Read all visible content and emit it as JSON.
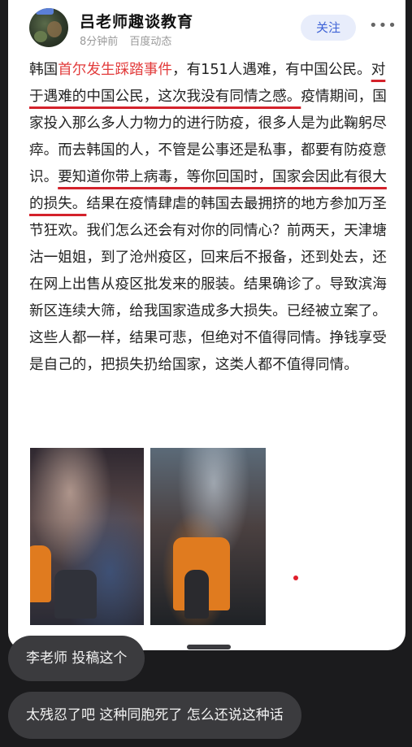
{
  "post": {
    "author": "吕老师趣谈教育",
    "time": "8分钟前",
    "source": "百度动态",
    "follow_label": "关注",
    "more_icon": "more-dots-icon",
    "paragraph": [
      {
        "text": "韩国",
        "style": ""
      },
      {
        "text": "首尔发生踩踏事件",
        "style": "hl"
      },
      {
        "text": "，有151人遇难，有中国公民。",
        "style": ""
      },
      {
        "text": "对于遇难的中国公民，这次我没有同情之感。",
        "style": "ul"
      },
      {
        "text": "疫情期间，国家投入那么多人力物力的进行防疫，很多人是为此鞠躬尽瘁。而去韩国的人，不管是公事还是私事，都要有防疫意识。",
        "style": ""
      },
      {
        "text": "要知道你带上病毒，等你回国时，国家会因此有很大的损失。",
        "style": "ul"
      },
      {
        "text": "结果在疫情肆虐的韩国去最拥挤的地方参加万圣节狂欢。我们怎么还会有对你的同情心？前两天，天津塘沽一姐姐，到了沧州疫区，回来后不报备，还到处去，还在网上出售从疫区批发来的服装。结果确诊了。导致滨海新区连续大筛，给我国家造成多大损失。已经被立案了。这些人都一样，结果可悲，但绝对不值得同情。挣钱享受是自己的，把损失扔给国家，这类人都不值得同情。",
        "style": ""
      }
    ]
  },
  "chat": {
    "message_1": "李老师 投稿这个",
    "message_2": "太残忍了吧 这种同胞死了 怎么还说这种话"
  },
  "colors": {
    "highlight": "#e23c3c",
    "underline": "#d4222b",
    "follow_text": "#3d62d6",
    "follow_bg": "#e8edfb",
    "bubble_bg": "#3b3b3e"
  }
}
